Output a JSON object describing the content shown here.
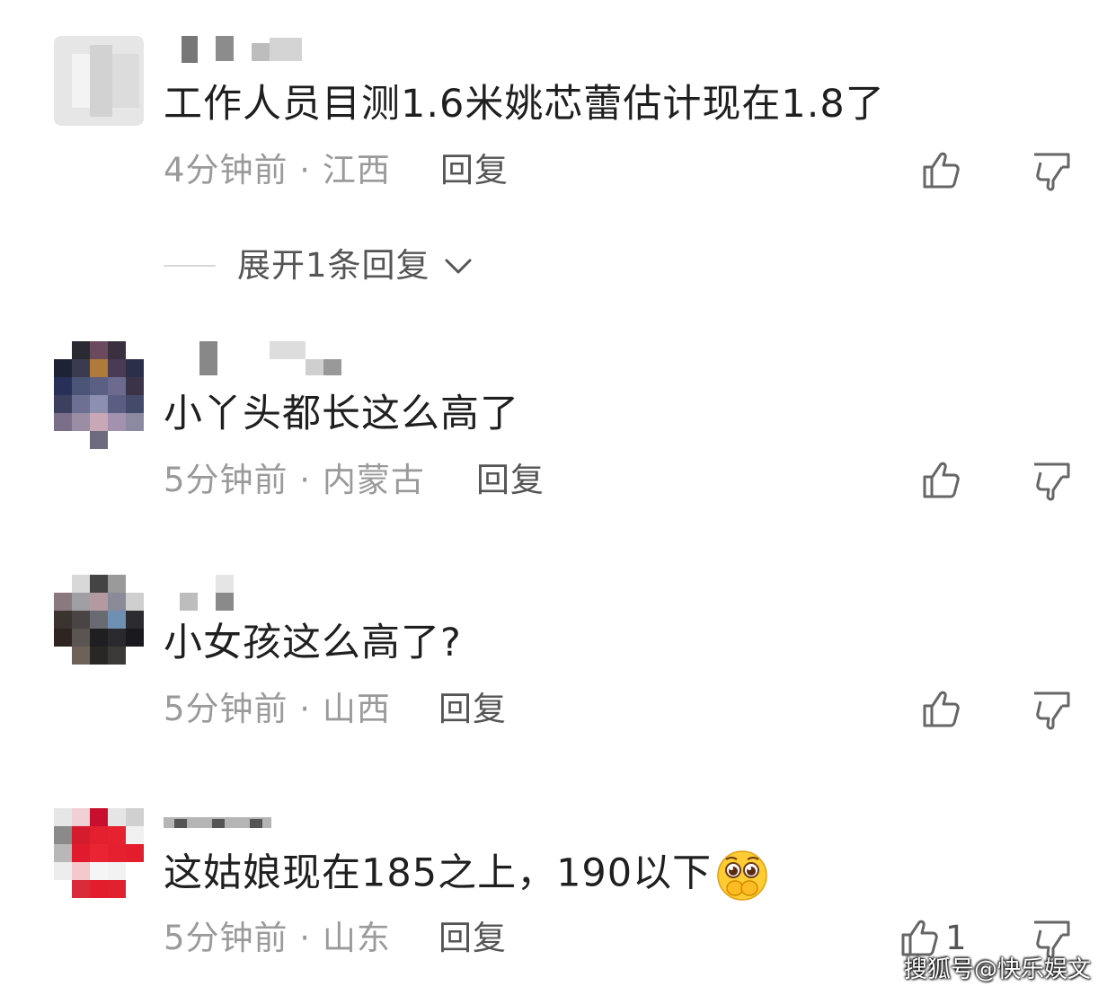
{
  "comments": [
    {
      "username": "",
      "text": "工作人员目测1.6米姚芯蕾估计现在1.8了",
      "meta": "4分钟前 · 江西",
      "reply_label": "回复",
      "like_count": "",
      "expand_label": "展开1条回复"
    },
    {
      "username": "",
      "text": "小丫头都长这么高了",
      "meta": "5分钟前 · 内蒙古",
      "reply_label": "回复",
      "like_count": ""
    },
    {
      "username": "",
      "text": "小女孩这么高了?",
      "meta": "5分钟前 · 山西",
      "reply_label": "回复",
      "like_count": ""
    },
    {
      "username": "",
      "text": "这姑娘现在185之上，190以下",
      "meta": "5分钟前 · 山东",
      "reply_label": "回复",
      "like_count": "1",
      "emoji": "pleading-face-covering-mouth-emoji"
    }
  ],
  "icons": {
    "like": "thumbs-up-icon",
    "dislike": "thumbs-down-icon",
    "expand": "chevron-down-icon"
  },
  "watermark": "搜狐号@快乐娱文",
  "colors": {
    "text": "#1f1f1f",
    "meta": "#9a9a9a",
    "reply": "#555555",
    "icon": "#666666"
  }
}
